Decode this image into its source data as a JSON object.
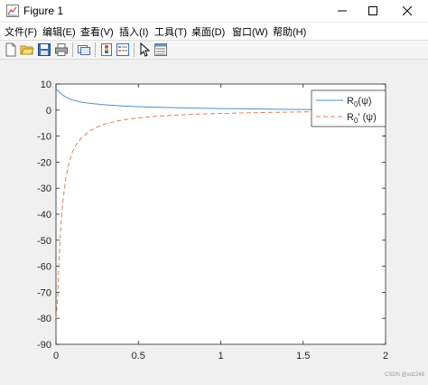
{
  "window": {
    "title": "Figure 1",
    "icons": {
      "app": "matlab-figure-icon",
      "minimize": "minimize-icon",
      "maximize": "maximize-icon",
      "close": "close-icon"
    }
  },
  "menu": {
    "items": [
      "文件(F)",
      "编辑(E)",
      "查看(V)",
      "插入(I)",
      "工具(T)",
      "桌面(D)",
      "窗口(W)",
      "帮助(H)"
    ]
  },
  "toolbar": {
    "icons": [
      "new-figure-icon",
      "open-file-icon",
      "save-icon",
      "print-icon",
      "link-plot-icon",
      "insert-colorbar-icon",
      "insert-legend-icon",
      "pointer-icon",
      "property-inspector-icon"
    ]
  },
  "chart_data": {
    "type": "line",
    "xlim": [
      0,
      2
    ],
    "ylim": [
      -90,
      10
    ],
    "x_ticks": [
      "0",
      "0.5",
      "1",
      "1.5",
      "2"
    ],
    "y_ticks": [
      "10",
      "0",
      "-10",
      "-20",
      "-30",
      "-40",
      "-50",
      "-60",
      "-70",
      "-80",
      "-90"
    ],
    "grid": false,
    "legend_position": "top-right",
    "series": [
      {
        "name": "R0(ψ)",
        "style": "solid",
        "color": "#4f8fc7",
        "x": [
          0.001,
          0.01,
          0.02,
          0.04,
          0.06,
          0.08,
          0.1,
          0.15,
          0.2,
          0.3,
          0.4,
          0.5,
          0.6,
          0.8,
          1.0,
          1.2,
          1.4,
          1.6,
          1.8,
          2.0
        ],
        "y": [
          8.2,
          7.6,
          6.9,
          5.8,
          5.0,
          4.4,
          3.9,
          3.1,
          2.6,
          2.0,
          1.6,
          1.3,
          1.1,
          0.8,
          0.6,
          0.45,
          0.3,
          0.2,
          0.1,
          0.0
        ]
      },
      {
        "name": "R0'(ψ)",
        "style": "dashed",
        "color": "#d9825b",
        "x": [
          0.001,
          0.01,
          0.02,
          0.03,
          0.04,
          0.06,
          0.08,
          0.1,
          0.12,
          0.15,
          0.2,
          0.25,
          0.3,
          0.4,
          0.5,
          0.6,
          0.8,
          1.0,
          1.2,
          1.5,
          2.0
        ],
        "y": [
          -80,
          -72,
          -56,
          -44,
          -36,
          -26,
          -20,
          -16,
          -13.5,
          -11,
          -8.2,
          -6.5,
          -5.3,
          -3.8,
          -3.0,
          -2.4,
          -1.7,
          -1.3,
          -1.0,
          -0.7,
          -0.4
        ]
      }
    ]
  },
  "legend": {
    "entries": [
      {
        "base": "R",
        "sub": "0",
        "suffix": "(ψ)"
      },
      {
        "base": "R",
        "sub": "0",
        "suffix": "' (ψ)"
      }
    ]
  },
  "watermark": "CSDN @xdz249"
}
